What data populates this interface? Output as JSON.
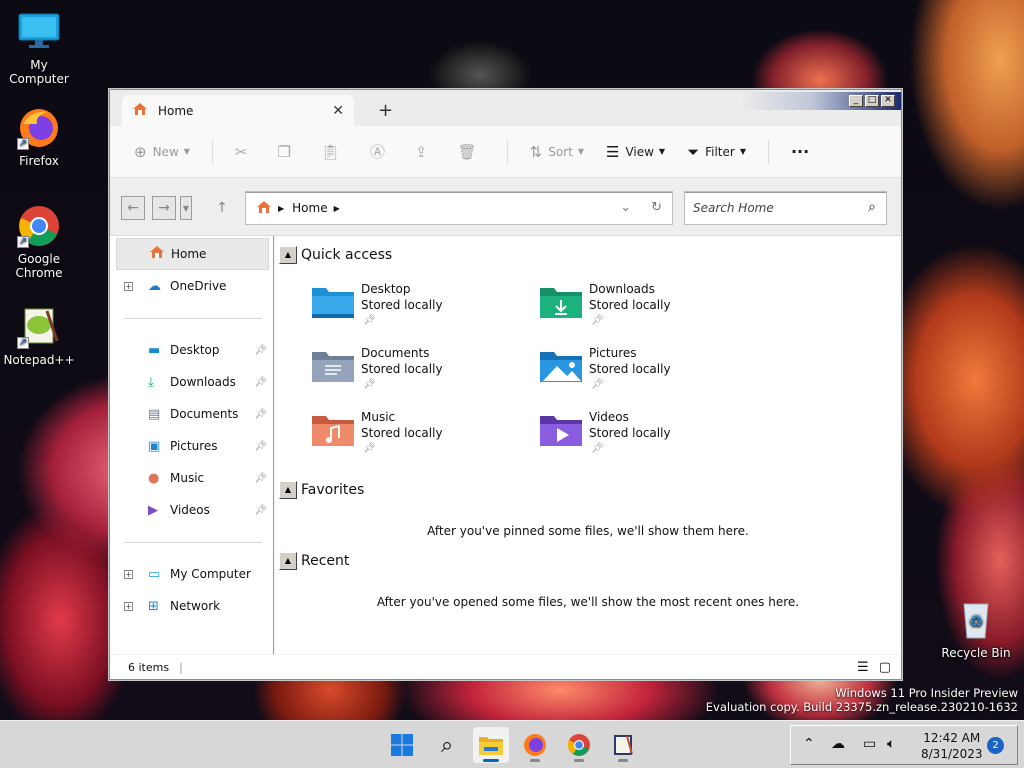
{
  "desktop": {
    "icons": [
      {
        "label": "My Computer"
      },
      {
        "label": "Firefox"
      },
      {
        "label": "Google Chrome"
      },
      {
        "label": "Notepad++"
      },
      {
        "label": "Recycle Bin"
      }
    ],
    "watermark": {
      "line1": "Windows 11 Pro Insider Preview",
      "line2": "Evaluation copy. Build 23375.zn_release.230210-1632"
    }
  },
  "window": {
    "tab_title": "Home",
    "tab_close": "✕",
    "new_tab": "+",
    "caption_buttons": {
      "minimize": "_",
      "maximize": "□",
      "close": "✕"
    },
    "toolbar": {
      "new_label": "New",
      "sort_label": "Sort",
      "view_label": "View",
      "filter_label": "Filter",
      "more_label": "···"
    },
    "address": {
      "crumb": "Home"
    },
    "search": {
      "placeholder": "Search Home"
    },
    "nav_pane": {
      "home": "Home",
      "onedrive": "OneDrive",
      "pinned": [
        "Desktop",
        "Downloads",
        "Documents",
        "Pictures",
        "Music",
        "Videos"
      ],
      "my_computer": "My Computer",
      "network": "Network"
    },
    "content": {
      "quick_access_title": "Quick access",
      "folders": [
        {
          "name": "Desktop",
          "sub": "Stored locally",
          "color": "#1e90d6"
        },
        {
          "name": "Downloads",
          "sub": "Stored locally",
          "color": "#18a370"
        },
        {
          "name": "Documents",
          "sub": "Stored locally",
          "color": "#7e8ea6"
        },
        {
          "name": "Pictures",
          "sub": "Stored locally",
          "color": "#1c86d0"
        },
        {
          "name": "Music",
          "sub": "Stored locally",
          "color": "#e0745a"
        },
        {
          "name": "Videos",
          "sub": "Stored locally",
          "color": "#7a4ccc"
        }
      ],
      "favorites_title": "Favorites",
      "favorites_empty": "After you've pinned some files, we'll show them here.",
      "recent_title": "Recent",
      "recent_empty": "After you've opened some files, we'll show the most recent ones here."
    },
    "status": {
      "items_count": "6 items",
      "separator": "|"
    }
  },
  "taskbar": {
    "clock_time": "12:42 AM",
    "clock_date": "8/31/2023",
    "notification_count": "2"
  }
}
